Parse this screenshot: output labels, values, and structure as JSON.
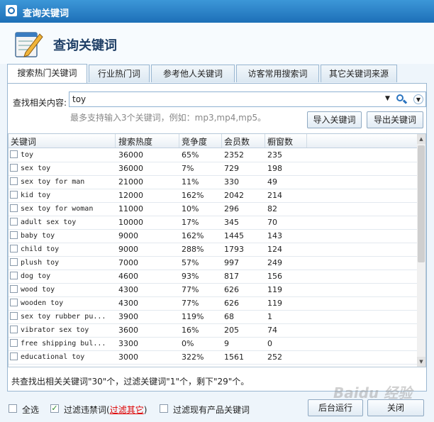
{
  "window": {
    "title": "查询关键词",
    "close_icon": "close-icon"
  },
  "header": {
    "title": "查询关键词"
  },
  "tabs": [
    {
      "label": "搜索热门关键词"
    },
    {
      "label": "行业热门词"
    },
    {
      "label": "参考他人关键词"
    },
    {
      "label": "访客常用搜索词"
    },
    {
      "label": "其它关键词来源"
    }
  ],
  "search": {
    "label": "查找相关内容:",
    "value": "toy",
    "hint": "最多支持输入3个关键词，例如：mp3,mp4,mp5。",
    "import_label": "导入关键词",
    "export_label": "导出关键词"
  },
  "table": {
    "columns": [
      "关键词",
      "搜索热度",
      "竞争度",
      "会员数",
      "橱窗数"
    ],
    "rows": [
      [
        "toy",
        "36000",
        "65%",
        "2352",
        "235"
      ],
      [
        "sex toy",
        "36000",
        "7%",
        "729",
        "198"
      ],
      [
        "sex toy for man",
        "21000",
        "11%",
        "330",
        "49"
      ],
      [
        "kid toy",
        "12000",
        "162%",
        "2042",
        "214"
      ],
      [
        "sex toy for woman",
        "11000",
        "10%",
        "296",
        "82"
      ],
      [
        "adult sex toy",
        "10000",
        "17%",
        "345",
        "70"
      ],
      [
        "baby toy",
        "9000",
        "162%",
        "1445",
        "143"
      ],
      [
        "child toy",
        "9000",
        "288%",
        "1793",
        "124"
      ],
      [
        "plush toy",
        "7000",
        "57%",
        "997",
        "249"
      ],
      [
        "dog toy",
        "4600",
        "93%",
        "817",
        "156"
      ],
      [
        "wood toy",
        "4300",
        "77%",
        "626",
        "119"
      ],
      [
        "wooden toy",
        "4300",
        "77%",
        "626",
        "119"
      ],
      [
        "sex toy rubber pu...",
        "3900",
        "119%",
        "68",
        "1"
      ],
      [
        "vibrator sex toy",
        "3600",
        "16%",
        "205",
        "74"
      ],
      [
        "free shipping bul...",
        "3300",
        "0%",
        "9",
        "0"
      ],
      [
        "educational toy",
        "3000",
        "322%",
        "1561",
        "252"
      ]
    ]
  },
  "summary": "共查找出相关关键词\"30\"个，过滤关键词\"1\"个，剩下\"29\"个。",
  "footer": {
    "select_all": "全选",
    "filter_banned": "过滤违禁词(",
    "filter_other": "过滤其它",
    "filter_close": ")",
    "filter_products": "过滤现有产品关键词",
    "background_run": "后台运行",
    "close": "关闭"
  },
  "watermark": "Baidu 经验"
}
